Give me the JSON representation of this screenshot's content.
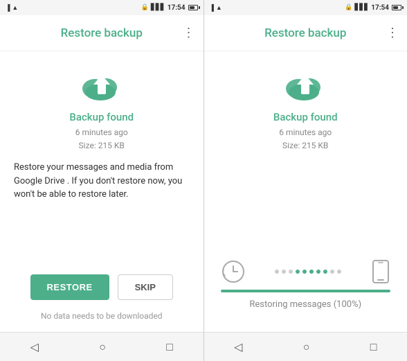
{
  "left_phone": {
    "status_bar": {
      "time": "17:54"
    },
    "app_bar": {
      "title": "Restore backup",
      "more_icon": "⋮"
    },
    "content": {
      "backup_found_label": "Backup found",
      "time_ago": "6 minutes ago",
      "size": "Size: 215 KB",
      "description": "Restore your messages and media from Google Drive . If you don't restore now, you won't be able to restore later.",
      "restore_button": "RESTORE",
      "skip_button": "SKIP",
      "no_data_text": "No data needs to be downloaded"
    },
    "nav": {
      "back": "◁",
      "home": "○",
      "recent": "□"
    }
  },
  "right_phone": {
    "status_bar": {
      "time": "17:54"
    },
    "app_bar": {
      "title": "Restore backup",
      "more_icon": "⋮"
    },
    "content": {
      "backup_found_label": "Backup found",
      "time_ago": "6 minutes ago",
      "size": "Size: 215 KB",
      "progress_percent": "100",
      "restoring_text": "Restoring messages (100%)"
    },
    "dots": [
      {
        "active": false
      },
      {
        "active": false
      },
      {
        "active": false
      },
      {
        "active": true
      },
      {
        "active": true
      },
      {
        "active": true
      },
      {
        "active": true
      },
      {
        "active": true
      },
      {
        "active": false
      },
      {
        "active": false
      }
    ],
    "nav": {
      "back": "◁",
      "home": "○",
      "recent": "□"
    }
  }
}
